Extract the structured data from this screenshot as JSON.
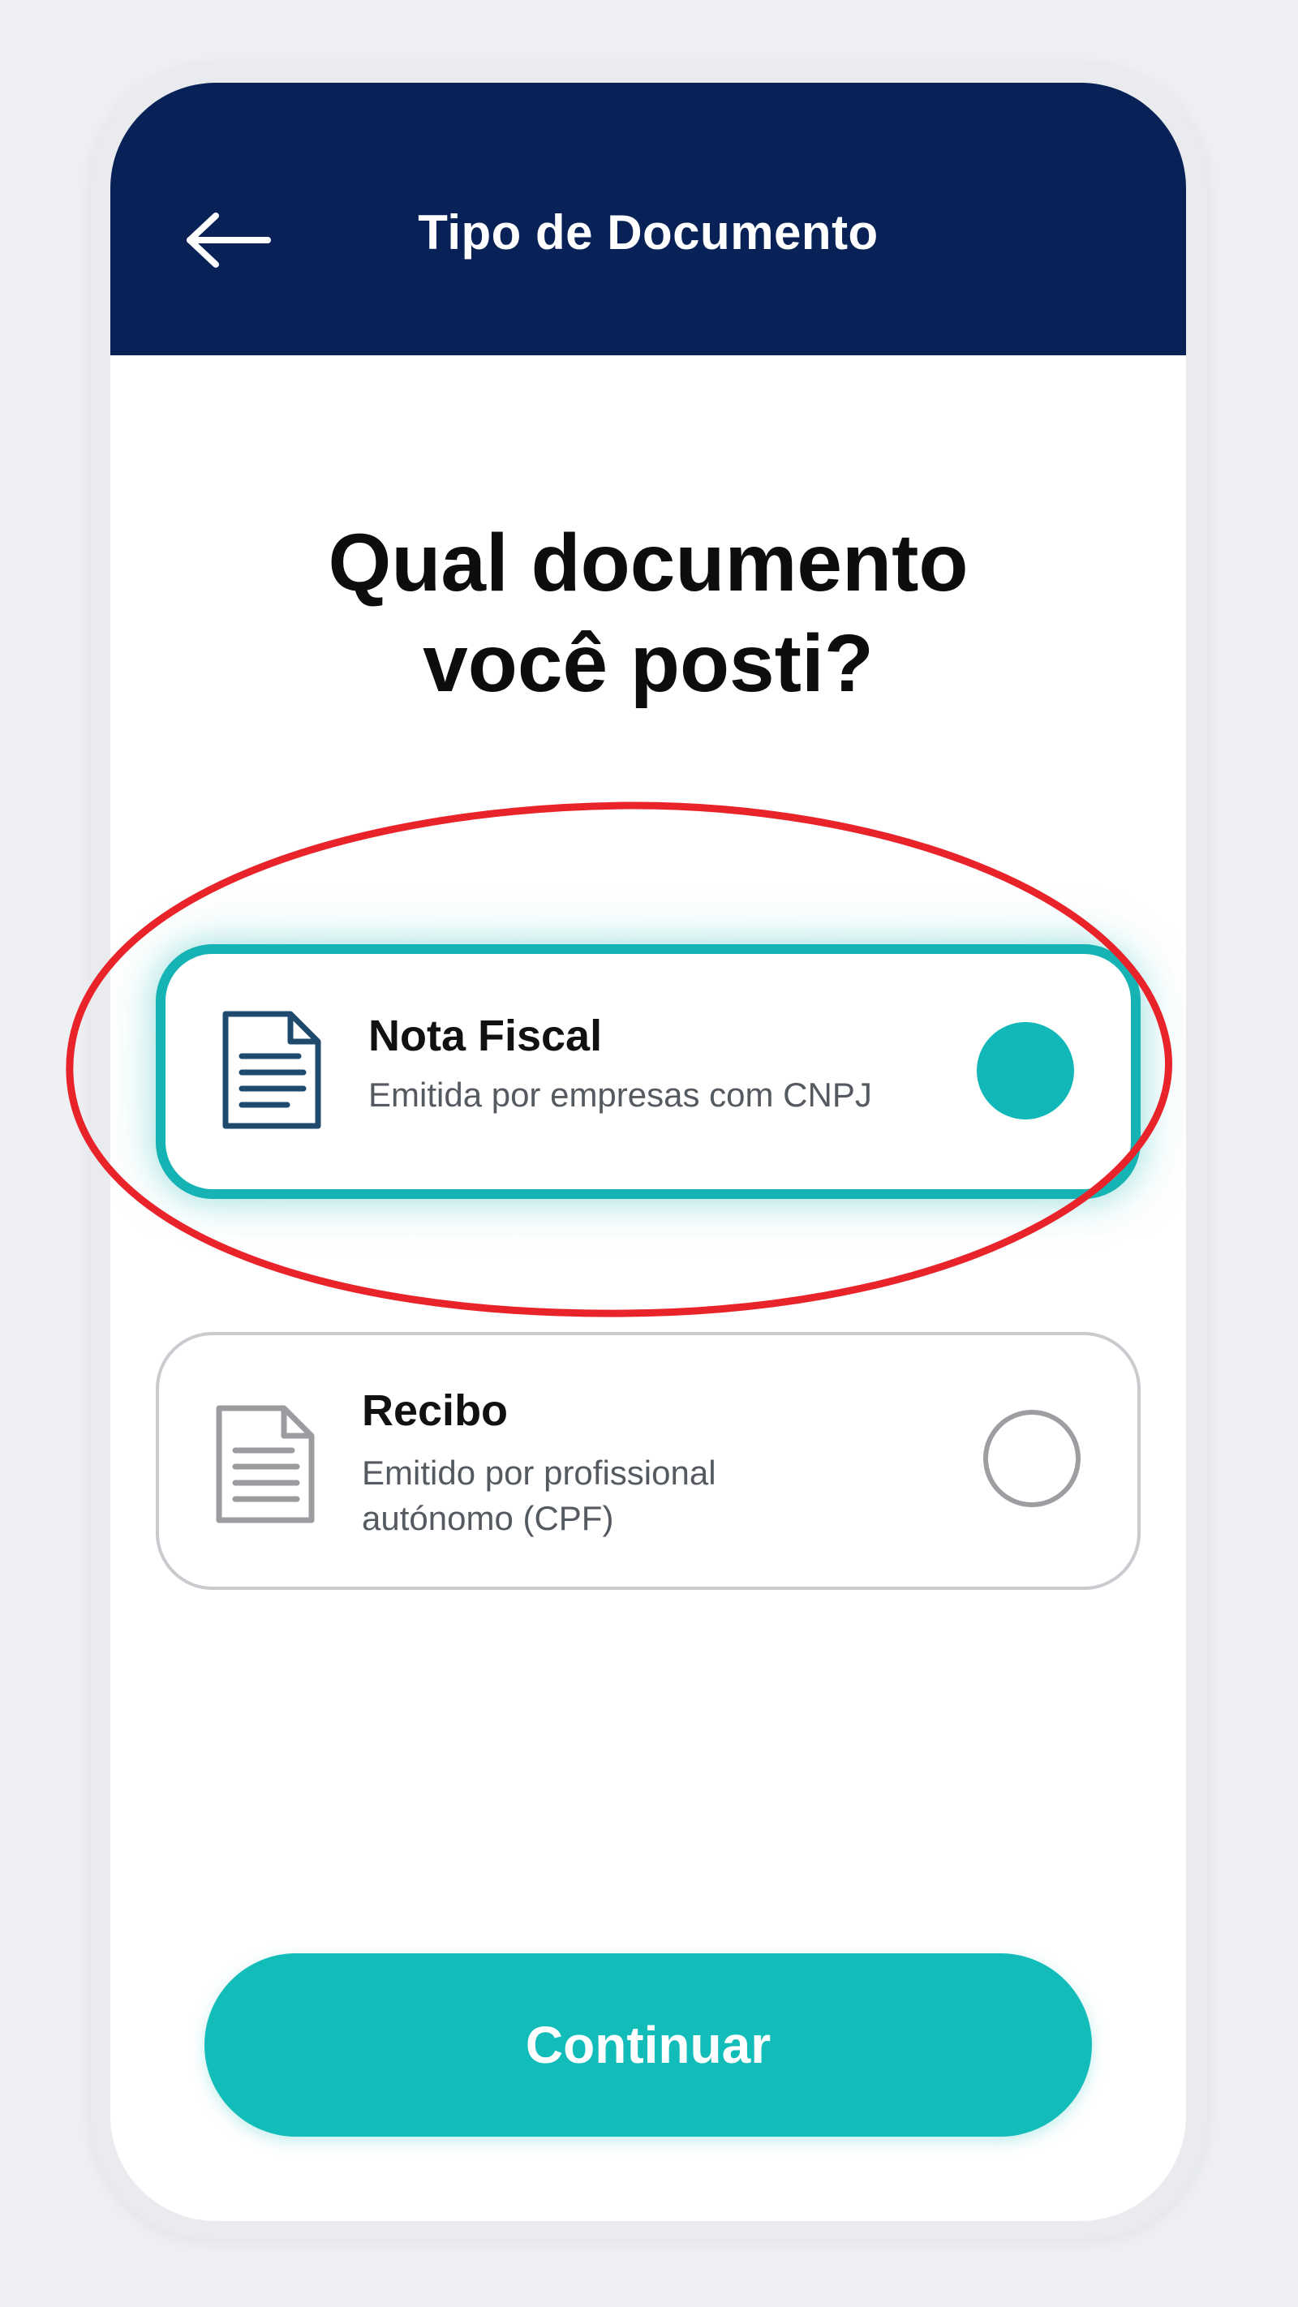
{
  "header": {
    "title": "Tipo de Documento",
    "back_icon": "arrow-left-icon",
    "background_color": "#082257"
  },
  "question": {
    "line1": "Qual documento",
    "line2": "você posti?"
  },
  "options": [
    {
      "title": "Nota Fiscal",
      "description": "Emitida por empresas com CNPJ",
      "icon": "document-icon",
      "selected": true
    },
    {
      "title": "Recibo",
      "description_line1": "Emitido por profissional",
      "description_line2": "autónomo (CPF)",
      "icon": "document-icon",
      "selected": false
    }
  ],
  "continue_button": {
    "label": "Continuar"
  },
  "colors": {
    "accent": "#12bcb9",
    "selected_border": "#16b3b4",
    "annotation": "#e8242a"
  }
}
